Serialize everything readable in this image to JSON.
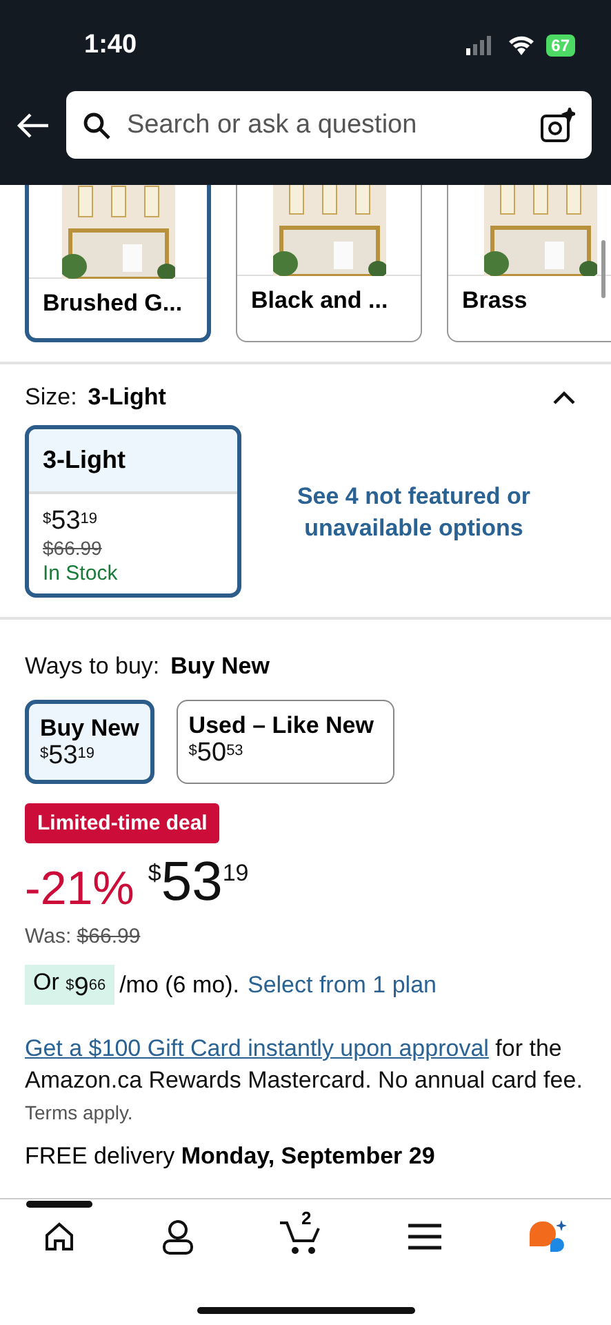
{
  "status_bar": {
    "time": "1:40",
    "battery": "67"
  },
  "search": {
    "placeholder": "Search or ask a question"
  },
  "swatches": [
    {
      "label": "Brushed G...",
      "selected": true
    },
    {
      "label": "Black and ...",
      "selected": false
    },
    {
      "label": "Brass",
      "selected": false
    }
  ],
  "size": {
    "label": "Size:",
    "value": "3-Light",
    "expanded": true,
    "options": [
      {
        "name": "3-Light",
        "selected": true,
        "price": {
          "symbol": "$",
          "whole": "53",
          "fraction": "19"
        },
        "was": "$66.99",
        "stock": "In Stock"
      }
    ],
    "more_link": "See 4 not featured or unavailable options"
  },
  "ways_to_buy": {
    "label": "Ways to buy:",
    "value": "Buy New",
    "options": [
      {
        "name": "Buy New",
        "selected": true,
        "price": {
          "symbol": "$",
          "whole": "53",
          "fraction": "19"
        }
      },
      {
        "name": "Used – Like New",
        "selected": false,
        "price": {
          "symbol": "$",
          "whole": "50",
          "fraction": "53"
        }
      }
    ]
  },
  "deal_badge": "Limited-time deal",
  "discount": "-21%",
  "price": {
    "symbol": "$",
    "whole": "53",
    "fraction": "19"
  },
  "was": {
    "label": "Was:",
    "value": "$66.99"
  },
  "monthly": {
    "prefix": "Or",
    "price": {
      "symbol": "$",
      "whole": "9",
      "fraction": "66"
    },
    "terms": "/mo (6 mo).",
    "link": "Select from 1 plan"
  },
  "promo": {
    "link": "Get a $100 Gift Card instantly upon approval",
    "text": "for the Amazon.ca Rewards Mastercard. No annual card fee.",
    "terms": "Terms apply."
  },
  "delivery": {
    "prefix": "FREE delivery",
    "date": "Monday, September 29"
  },
  "bottom_nav": [
    {
      "kind": "home",
      "selected": true
    },
    {
      "kind": "account",
      "selected": false
    },
    {
      "kind": "cart",
      "count": "2",
      "selected": false
    },
    {
      "kind": "menu",
      "selected": false
    },
    {
      "kind": "assistant",
      "selected": false
    }
  ]
}
